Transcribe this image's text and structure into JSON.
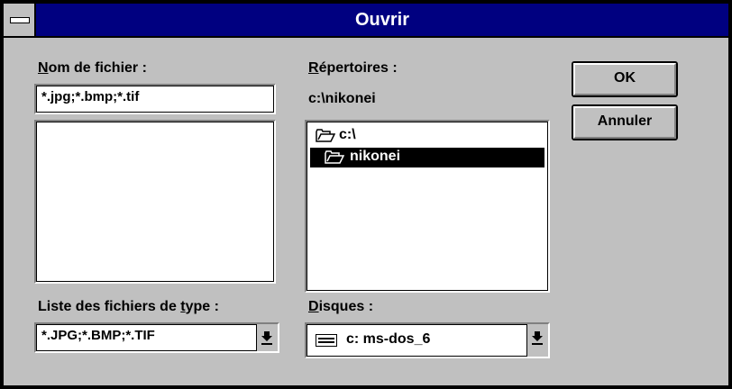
{
  "window": {
    "title": "Ouvrir"
  },
  "filename": {
    "label_first": "N",
    "label_rest": "om de fichier :",
    "value": "*.jpg;*.bmp;*.tif",
    "list_items": []
  },
  "directories": {
    "label_first": "R",
    "label_rest": "épertoires :",
    "current_path": "c:\\nikonei",
    "items": [
      {
        "name": "c:\\",
        "icon": "open-folder-icon",
        "selected": false
      },
      {
        "name": "nikonei",
        "icon": "open-folder-icon",
        "selected": true
      }
    ]
  },
  "filetype": {
    "label_pre": "Liste des fichiers de ",
    "label_u": "t",
    "label_post": "ype :",
    "value": "*.JPG;*.BMP;*.TIF"
  },
  "drives": {
    "label_first": "D",
    "label_rest": "isques :",
    "value": "c: ms-dos_6",
    "icon": "drive-icon"
  },
  "buttons": {
    "ok": "OK",
    "cancel": "Annuler"
  }
}
